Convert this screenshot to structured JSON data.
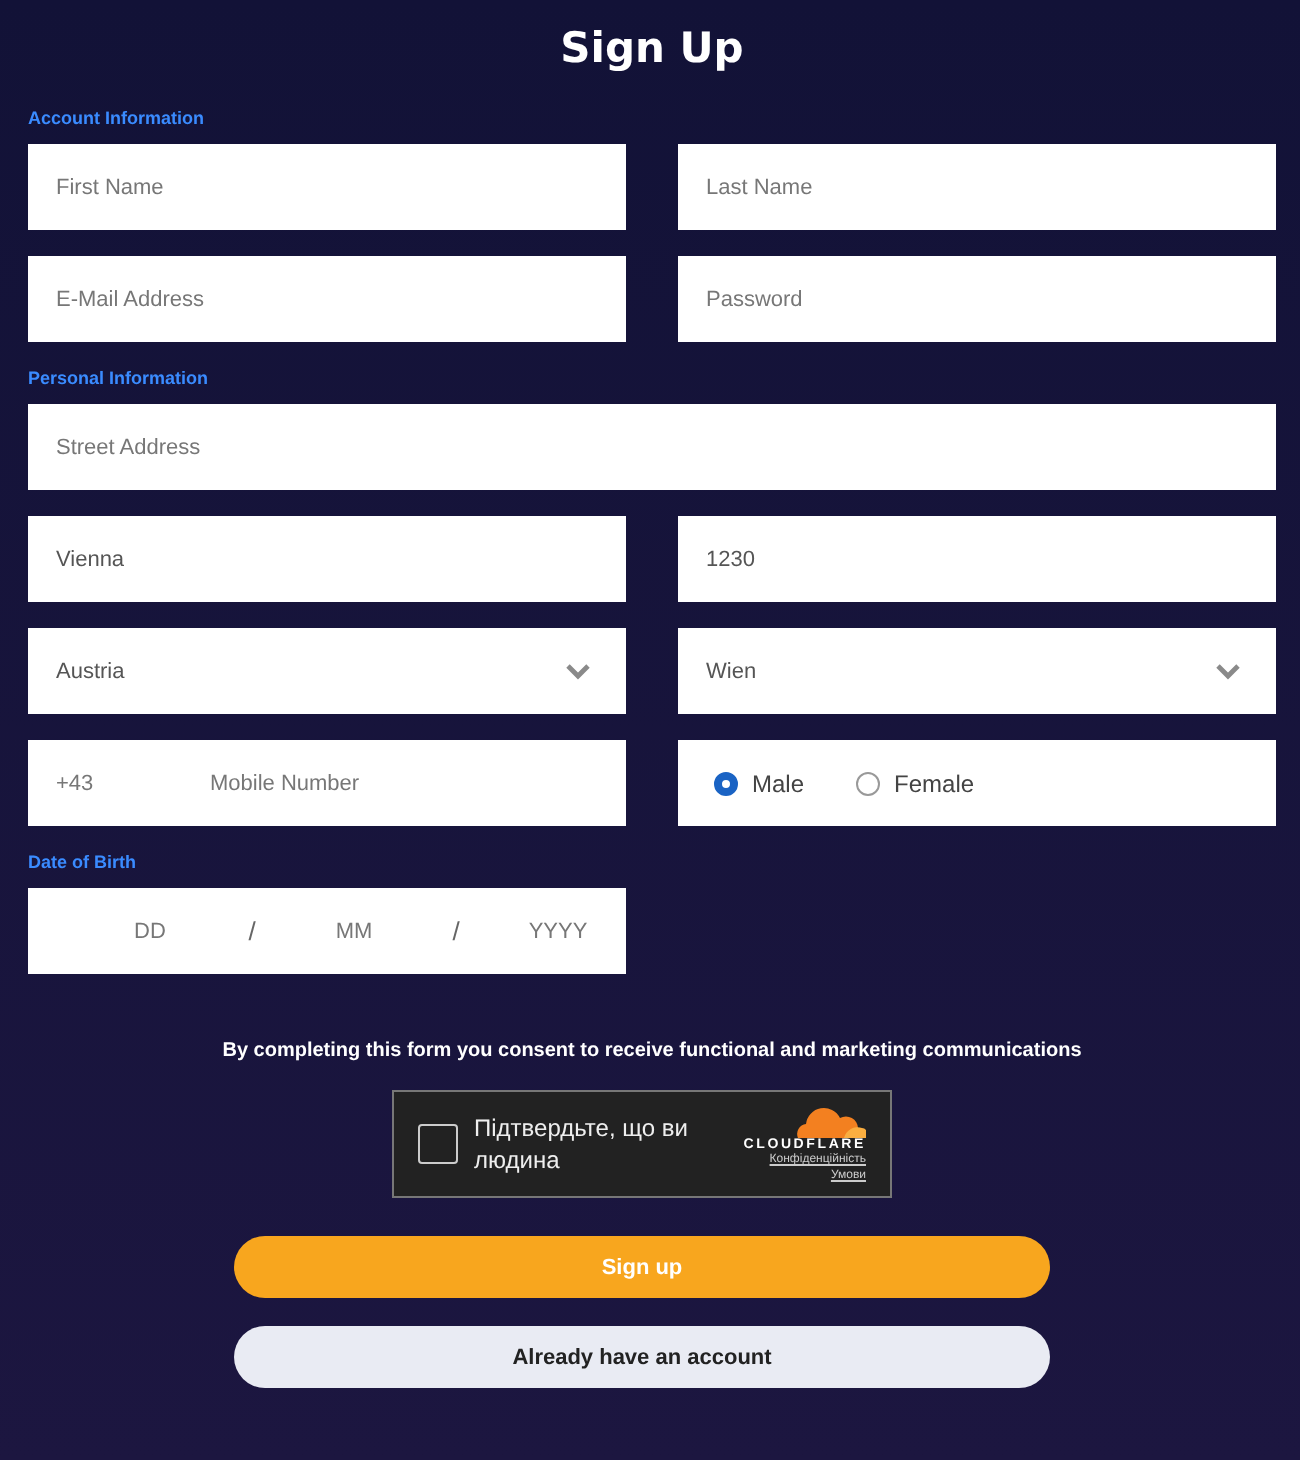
{
  "title": "Sign Up",
  "sections": [
    {
      "heading": "Account Information",
      "rows": [
        [
          {
            "kind": "text",
            "placeholder": "First Name"
          },
          {
            "kind": "text",
            "placeholder": "Last Name"
          }
        ],
        [
          {
            "kind": "text",
            "placeholder": "E-Mail Address"
          },
          {
            "kind": "password",
            "placeholder": "Password"
          }
        ]
      ]
    },
    {
      "heading": "Personal Information",
      "rows": [
        [
          {
            "kind": "text",
            "placeholder": "Street Address"
          }
        ],
        [
          {
            "kind": "text",
            "value": "Vienna"
          },
          {
            "kind": "text",
            "value": "1230"
          }
        ],
        [
          {
            "kind": "select",
            "value": "Austria"
          },
          {
            "kind": "select",
            "value": "Wien"
          }
        ],
        [
          {
            "kind": "phone",
            "prefix": "+43",
            "placeholder": "Mobile Number"
          },
          {
            "kind": "radio",
            "options": [
              {
                "label": "Male",
                "selected": true
              },
              {
                "label": "Female",
                "selected": false
              }
            ]
          }
        ]
      ]
    },
    {
      "heading": "Date of Birth",
      "rows": [
        [
          {
            "kind": "date",
            "parts": [
              {
                "kind": "part",
                "placeholder": "DD"
              },
              {
                "kind": "sep",
                "text": "/"
              },
              {
                "kind": "part",
                "placeholder": "MM"
              },
              {
                "kind": "sep",
                "text": "/"
              },
              {
                "kind": "part",
                "placeholder": "YYYY"
              }
            ]
          },
          {
            "kind": "empty"
          }
        ]
      ]
    }
  ],
  "consent": "By completing this form you consent to receive functional and marketing communications",
  "captcha": {
    "checked": false,
    "label": "Підтвердьте, що ви людина",
    "brand": "CLOUDFLARE",
    "links": [
      "Конфіденційність",
      "Умови"
    ]
  },
  "buttons": [
    {
      "kind": "primary",
      "label": "Sign up"
    },
    {
      "kind": "secondary",
      "label": "Already have an account"
    }
  ]
}
